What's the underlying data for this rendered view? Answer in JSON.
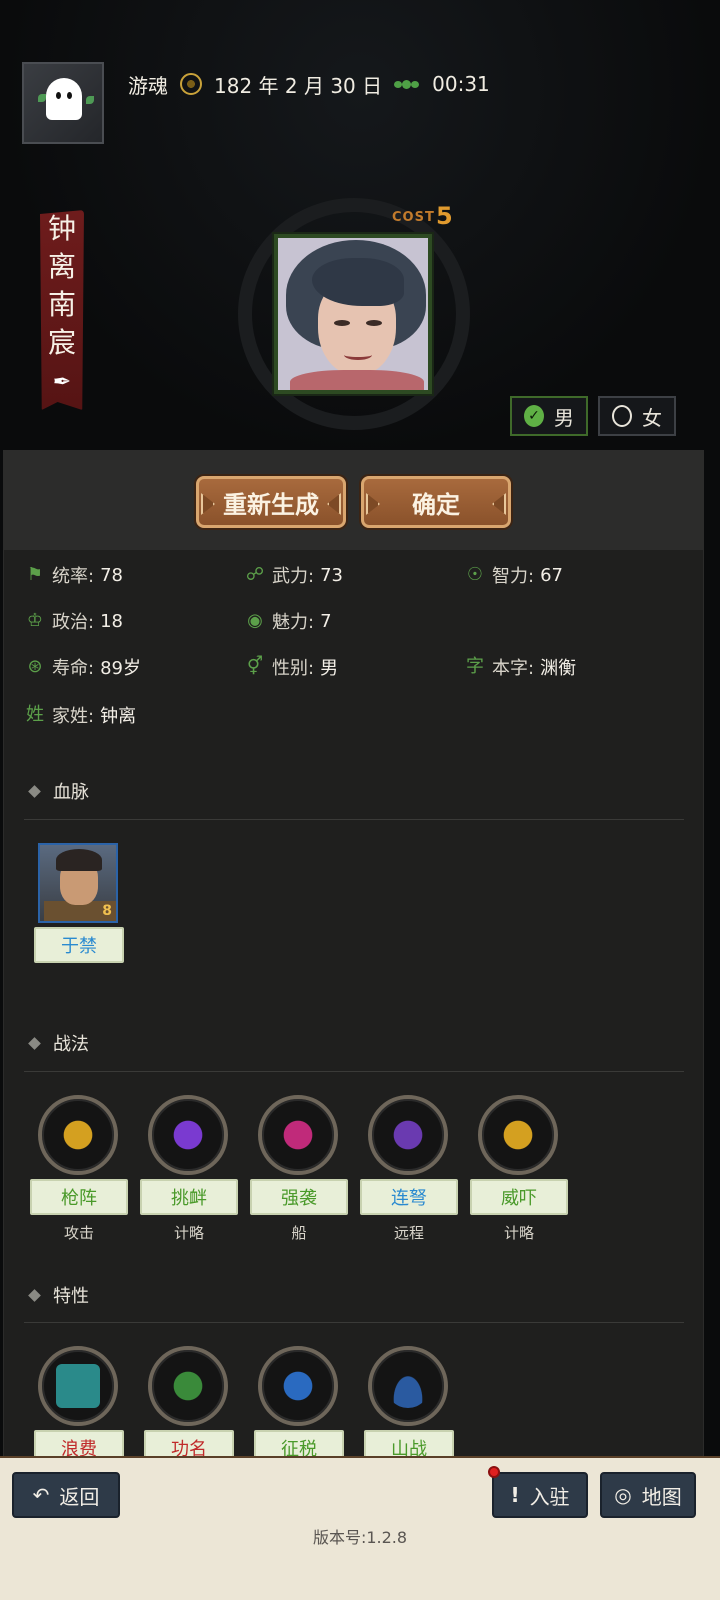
{
  "header": {
    "player_name": "游魂",
    "date": "182 年 2 月 30 日",
    "time": "00:31"
  },
  "character": {
    "name_chars": [
      "钟",
      "离",
      "南",
      "宸"
    ],
    "cost_label": "COST",
    "cost_value": "5",
    "gender_options": [
      {
        "label": "男",
        "selected": true
      },
      {
        "label": "女",
        "selected": false
      }
    ]
  },
  "actions": {
    "regenerate": "重新生成",
    "confirm": "确定"
  },
  "stats": [
    {
      "label": "统率:",
      "value": "78",
      "icon": "flag-icon"
    },
    {
      "label": "武力:",
      "value": "73",
      "icon": "arm-icon"
    },
    {
      "label": "智力:",
      "value": "67",
      "icon": "brain-icon"
    },
    {
      "label": "政治:",
      "value": "18",
      "icon": "crown-icon"
    },
    {
      "label": "魅力:",
      "value": "7",
      "icon": "eye-icon"
    },
    {
      "label": "寿命:",
      "value": "89岁",
      "icon": "clock-icon"
    },
    {
      "label": "性别:",
      "value": "男",
      "icon": "gender-icon"
    },
    {
      "label": "本字:",
      "value": "渊衡",
      "icon": "字"
    },
    {
      "label": "家姓:",
      "value": "钟离",
      "icon": "姓"
    }
  ],
  "bloodline": {
    "title": "血脉",
    "generals": [
      {
        "name": "于禁",
        "rank": "8"
      }
    ]
  },
  "tactics": {
    "title": "战法",
    "items": [
      {
        "name": "枪阵",
        "type": "攻击",
        "color": "#d4a020"
      },
      {
        "name": "挑衅",
        "type": "计略",
        "color": "#7a3ad0"
      },
      {
        "name": "强袭",
        "type": "船",
        "color": "#c02a7a"
      },
      {
        "name": "连弩",
        "type": "远程",
        "color": "#6a3ab0"
      },
      {
        "name": "威吓",
        "type": "计略",
        "color": "#d4a020"
      }
    ]
  },
  "traits": {
    "title": "特性",
    "items": [
      {
        "name": "浪费",
        "color": "#2a8a8a"
      },
      {
        "name": "功名",
        "color": "#3a8a3a"
      },
      {
        "name": "征税",
        "color": "#2a6ac0"
      },
      {
        "name": "山战",
        "color": "#2a5aa0"
      }
    ]
  },
  "footer": {
    "back": "返回",
    "station": "入驻",
    "map": "地图",
    "version": "版本号:1.2.8"
  }
}
